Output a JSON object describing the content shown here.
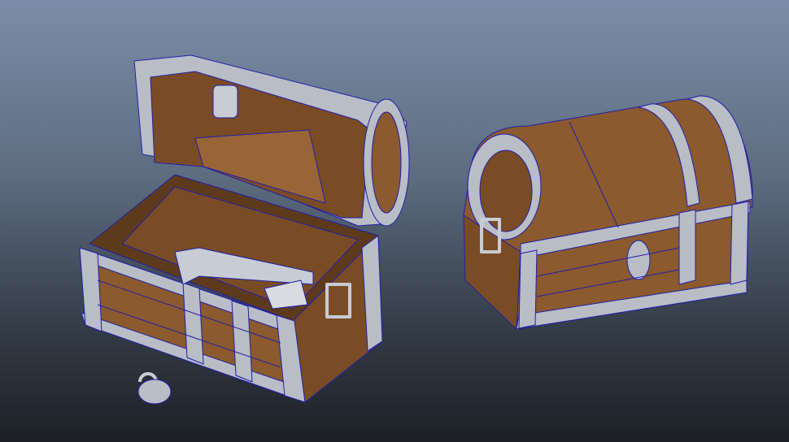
{
  "scene": {
    "objects": [
      "open-treasure-chest",
      "closed-treasure-chest",
      "padlock"
    ],
    "colors": {
      "wood": "#8b5a2e",
      "wood_dark": "#5e3a1c",
      "metal": "#b9bdc6",
      "metal_dark": "#7d828c",
      "wire": "#1f1fa8",
      "bg_top": "#7b8da8",
      "bg_bottom": "#1c2026"
    }
  }
}
